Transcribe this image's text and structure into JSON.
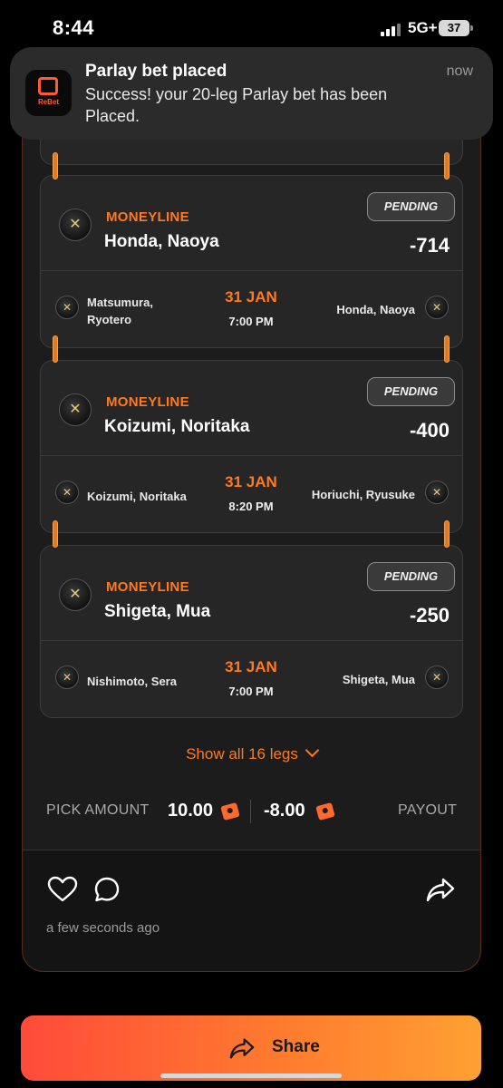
{
  "status_bar": {
    "time": "8:44",
    "network": "5G+",
    "battery": "37"
  },
  "notification": {
    "app_name": "ReBet",
    "title": "Parlay bet placed",
    "time": "now",
    "body": "Success! your 20-leg Parlay bet has been Placed."
  },
  "legs": [
    {
      "market": "MONEYLINE",
      "pick": "Honda, Naoya",
      "odds": "-714",
      "status": "PENDING",
      "player_left": "Matsumura, Ryotero",
      "player_right": "Honda, Naoya",
      "date": "31 JAN",
      "time": "7:00 PM"
    },
    {
      "market": "MONEYLINE",
      "pick": "Koizumi, Noritaka",
      "odds": "-400",
      "status": "PENDING",
      "player_left": "Koizumi, Noritaka",
      "player_right": "Horiuchi, Ryusuke",
      "date": "31 JAN",
      "time": "8:20 PM"
    },
    {
      "market": "MONEYLINE",
      "pick": "Shigeta, Mua",
      "odds": "-250",
      "status": "PENDING",
      "player_left": "Nishimoto, Sera",
      "player_right": "Shigeta, Mua",
      "date": "31 JAN",
      "time": "7:00 PM"
    }
  ],
  "show_all": "Show all 16 legs",
  "summary": {
    "pick_label": "PICK AMOUNT",
    "pick_amount": "10.00",
    "payout_amount": "-8.00",
    "payout_label": "PAYOUT"
  },
  "footer": {
    "timestamp": "a few seconds ago"
  },
  "share_button": {
    "label": "Share"
  },
  "colors": {
    "accent": "#ff7a1f",
    "background": "#000000",
    "card": "#262626"
  }
}
